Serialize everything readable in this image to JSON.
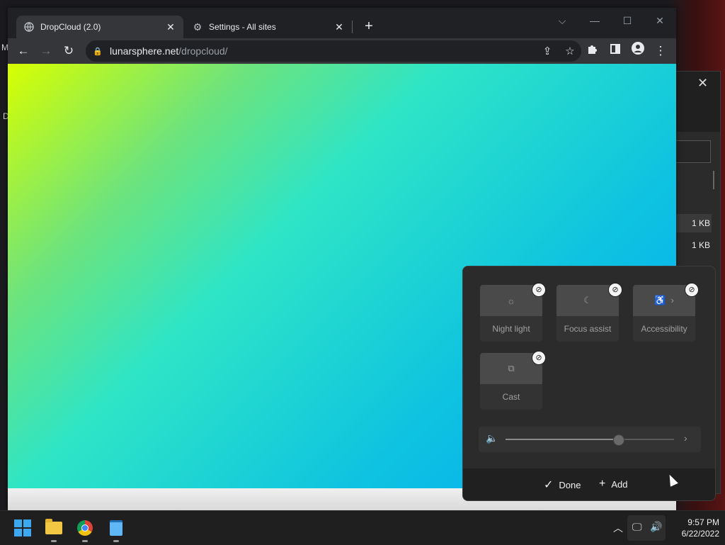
{
  "desktop": {
    "left_letters": [
      "M",
      "D"
    ]
  },
  "background_window": {
    "rows": [
      "1 KB",
      "1 KB"
    ]
  },
  "browser": {
    "tabs": [
      {
        "title": "DropCloud (2.0)",
        "icon": "globe-icon",
        "active": true
      },
      {
        "title": "Settings - All sites",
        "icon": "gear-icon",
        "active": false
      }
    ],
    "url_host": "lunarsphere.net",
    "url_path": "/dropcloud/"
  },
  "quick_settings": {
    "tiles": [
      {
        "label": "Night light",
        "icon": "sun-icon"
      },
      {
        "label": "Focus assist",
        "icon": "moon-icon"
      },
      {
        "label": "Accessibility",
        "icon": "accessibility-icon"
      },
      {
        "label": "Cast",
        "icon": "cast-icon"
      }
    ],
    "volume_level": 0.67,
    "done_label": "Done",
    "add_label": "Add"
  },
  "taskbar": {
    "apps": [
      "start",
      "file-explorer",
      "chrome",
      "notepad"
    ],
    "time": "9:57 PM",
    "date": "6/22/2022"
  }
}
